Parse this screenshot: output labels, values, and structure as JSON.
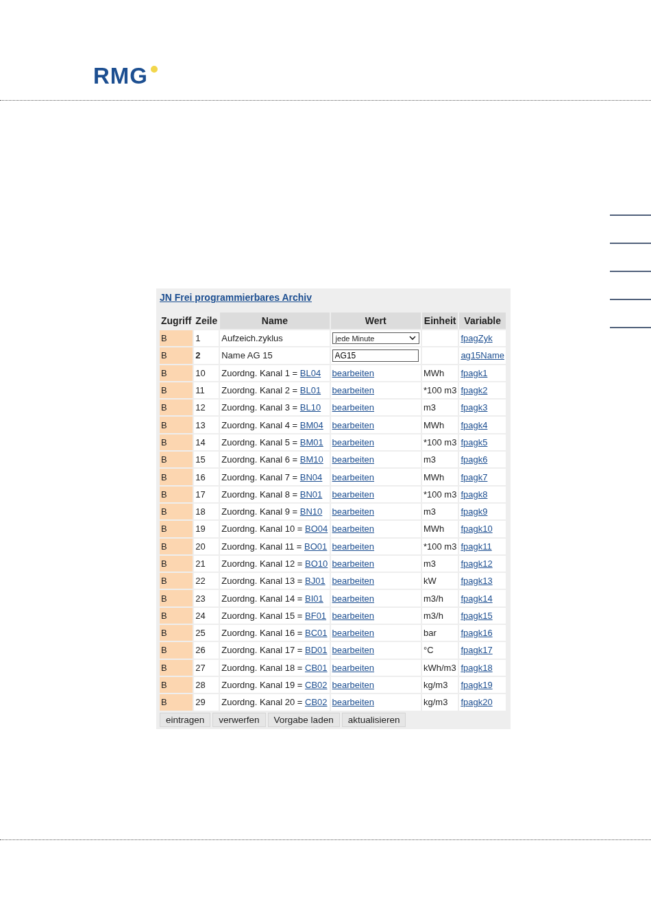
{
  "logo": {
    "text": "RMG"
  },
  "panel": {
    "title": "JN Frei programmierbares Archiv",
    "columns": [
      "Zugriff",
      "Zeile",
      "Name",
      "Wert",
      "Einheit",
      "Variable"
    ],
    "rows": [
      {
        "kind": "select",
        "access": "B",
        "line": "1",
        "bold_line": false,
        "name": "Aufzeich.zyklus",
        "value": "jede Minute",
        "unit": "",
        "variable": "fpagZyk"
      },
      {
        "kind": "input",
        "access": "B",
        "line": "2",
        "bold_line": true,
        "name": "Name AG 15",
        "value": "AG15",
        "unit": "",
        "variable": "ag15Name"
      },
      {
        "kind": "link",
        "access": "B",
        "line": "10",
        "bold_line": false,
        "name": "Zuordng. Kanal 1 =",
        "code": "BL04",
        "value": "bearbeiten",
        "unit": "MWh",
        "variable": "fpagk1"
      },
      {
        "kind": "link",
        "access": "B",
        "line": "11",
        "bold_line": false,
        "name": "Zuordng. Kanal 2 =",
        "code": "BL01",
        "value": "bearbeiten",
        "unit": "*100 m3",
        "variable": "fpagk2"
      },
      {
        "kind": "link",
        "access": "B",
        "line": "12",
        "bold_line": false,
        "name": "Zuordng. Kanal 3 =",
        "code": "BL10",
        "value": "bearbeiten",
        "unit": "m3",
        "variable": "fpagk3"
      },
      {
        "kind": "link",
        "access": "B",
        "line": "13",
        "bold_line": false,
        "name": "Zuordng. Kanal 4 =",
        "code": "BM04",
        "value": "bearbeiten",
        "unit": "MWh",
        "variable": "fpagk4"
      },
      {
        "kind": "link",
        "access": "B",
        "line": "14",
        "bold_line": false,
        "name": "Zuordng. Kanal 5 =",
        "code": "BM01",
        "value": "bearbeiten",
        "unit": "*100 m3",
        "variable": "fpagk5"
      },
      {
        "kind": "link",
        "access": "B",
        "line": "15",
        "bold_line": false,
        "name": "Zuordng. Kanal 6 =",
        "code": "BM10",
        "value": "bearbeiten",
        "unit": "m3",
        "variable": "fpagk6"
      },
      {
        "kind": "link",
        "access": "B",
        "line": "16",
        "bold_line": false,
        "name": "Zuordng. Kanal 7 =",
        "code": "BN04",
        "value": "bearbeiten",
        "unit": "MWh",
        "variable": "fpagk7"
      },
      {
        "kind": "link",
        "access": "B",
        "line": "17",
        "bold_line": false,
        "name": "Zuordng. Kanal 8 =",
        "code": "BN01",
        "value": "bearbeiten",
        "unit": "*100 m3",
        "variable": "fpagk8"
      },
      {
        "kind": "link",
        "access": "B",
        "line": "18",
        "bold_line": false,
        "name": "Zuordng. Kanal 9 =",
        "code": "BN10",
        "value": "bearbeiten",
        "unit": "m3",
        "variable": "fpagk9"
      },
      {
        "kind": "link",
        "access": "B",
        "line": "19",
        "bold_line": false,
        "name": "Zuordng. Kanal 10 =",
        "code": "BO04",
        "value": "bearbeiten",
        "unit": "MWh",
        "variable": "fpagk10"
      },
      {
        "kind": "link",
        "access": "B",
        "line": "20",
        "bold_line": false,
        "name": "Zuordng. Kanal 11 =",
        "code": "BO01",
        "value": "bearbeiten",
        "unit": "*100 m3",
        "variable": "fpagk11"
      },
      {
        "kind": "link",
        "access": "B",
        "line": "21",
        "bold_line": false,
        "name": "Zuordng. Kanal 12 =",
        "code": "BO10",
        "value": "bearbeiten",
        "unit": "m3",
        "variable": "fpagk12"
      },
      {
        "kind": "link",
        "access": "B",
        "line": "22",
        "bold_line": false,
        "name": "Zuordng. Kanal 13 =",
        "code": "BJ01",
        "value": "bearbeiten",
        "unit": "kW",
        "variable": "fpagk13"
      },
      {
        "kind": "link",
        "access": "B",
        "line": "23",
        "bold_line": false,
        "name": "Zuordng. Kanal 14 =",
        "code": "BI01",
        "value": "bearbeiten",
        "unit": "m3/h",
        "variable": "fpagk14"
      },
      {
        "kind": "link",
        "access": "B",
        "line": "24",
        "bold_line": false,
        "name": "Zuordng. Kanal 15 =",
        "code": "BF01",
        "value": "bearbeiten",
        "unit": "m3/h",
        "variable": "fpagk15"
      },
      {
        "kind": "link",
        "access": "B",
        "line": "25",
        "bold_line": false,
        "name": "Zuordng. Kanal 16 =",
        "code": "BC01",
        "value": "bearbeiten",
        "unit": "bar",
        "variable": "fpagk16"
      },
      {
        "kind": "link",
        "access": "B",
        "line": "26",
        "bold_line": false,
        "name": "Zuordng. Kanal 17 =",
        "code": "BD01",
        "value": "bearbeiten",
        "unit": "°C",
        "variable": "fpagk17"
      },
      {
        "kind": "link",
        "access": "B",
        "line": "27",
        "bold_line": false,
        "name": "Zuordng. Kanal 18 =",
        "code": "CB01",
        "value": "bearbeiten",
        "unit": "kWh/m3",
        "variable": "fpagk18"
      },
      {
        "kind": "link",
        "access": "B",
        "line": "28",
        "bold_line": false,
        "name": "Zuordng. Kanal 19 =",
        "code": "CB02",
        "value": "bearbeiten",
        "unit": "kg/m3",
        "variable": "fpagk19"
      },
      {
        "kind": "link",
        "access": "B",
        "line": "29",
        "bold_line": false,
        "name": "Zuordng. Kanal 20 =",
        "code": "CB02",
        "value": "bearbeiten",
        "unit": "kg/m3",
        "variable": "fpagk20"
      }
    ],
    "buttons": [
      "eintragen",
      "verwerfen",
      "Vorgabe laden",
      "aktualisieren"
    ]
  }
}
